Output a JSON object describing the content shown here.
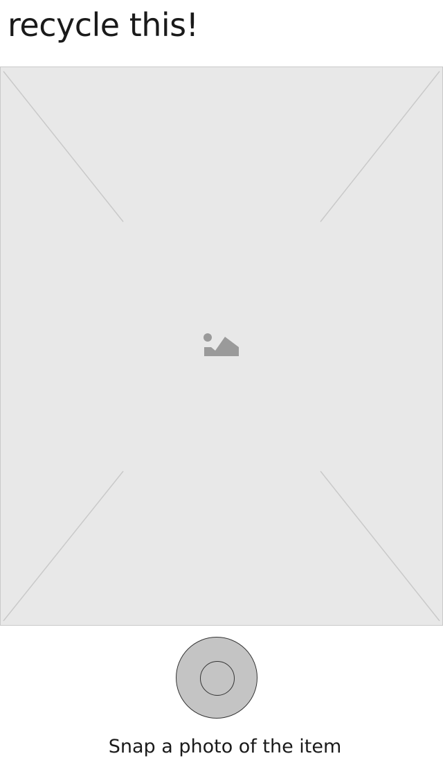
{
  "header": {
    "title": "recycle this!"
  },
  "camera": {
    "preview_icon": "image-placeholder-icon",
    "shutter_icon": "shutter-button-icon"
  },
  "footer": {
    "caption": "Snap a photo of the item"
  },
  "colors": {
    "preview_background": "#e8e8e8",
    "preview_lines": "#c9c9c9",
    "shutter_fill": "#c4c4c4",
    "icon_gray": "#9a9a9a"
  }
}
